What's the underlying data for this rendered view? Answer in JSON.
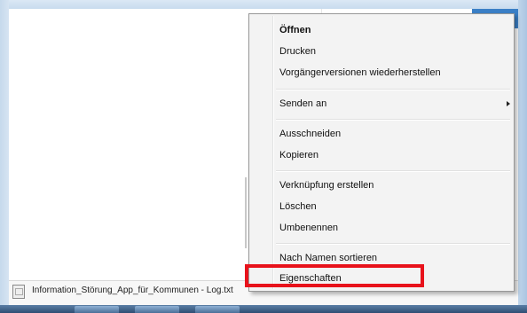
{
  "context_menu": {
    "items": {
      "open": "Öffnen",
      "print": "Drucken",
      "restore_versions": "Vorgängerversionen wiederherstellen",
      "send_to": "Senden an",
      "cut": "Ausschneiden",
      "copy": "Kopieren",
      "create_shortcut": "Verknüpfung erstellen",
      "delete": "Löschen",
      "rename": "Umbenennen",
      "sort_by_name": "Nach Namen sortieren",
      "properties": "Eigenschaften"
    },
    "highlight_color": "#e8121b"
  },
  "file_row": {
    "file_name": "Information_Störung_App_für_Kommunen - Log.txt",
    "icon": "text-file-icon"
  }
}
